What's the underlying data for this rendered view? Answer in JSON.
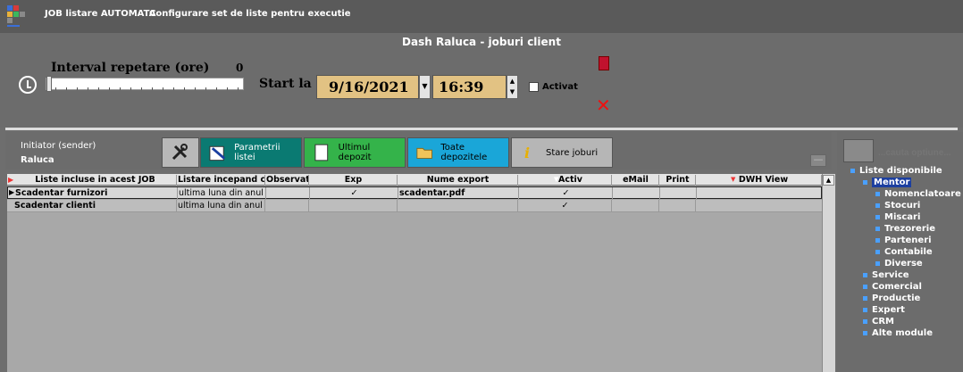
{
  "titlebar": {
    "app": "JOB listare AUTOMATA",
    "subtitle": "Configurare set de liste pentru executie"
  },
  "dash_title": "Dash Raluca - joburi client",
  "interval": {
    "label": "Interval repetare (ore)",
    "value": "0"
  },
  "start": {
    "label": "Start la",
    "date": "9/16/2021",
    "time": "16:39",
    "activ_label": "Activat"
  },
  "initiator": {
    "label": "Initiator (sender)",
    "value": "Raluca"
  },
  "toolbar": {
    "param": "Parametrii listei",
    "ultim": "Ultimul depozit",
    "toate": "Toate depozitele",
    "stare": "Stare joburi"
  },
  "grid": {
    "columns": [
      "Liste incluse in acest JOB",
      "Listare incepand cu",
      "Observatii",
      "Exp",
      "Nume export",
      "Activ",
      "eMail",
      "Print",
      "DWH View"
    ],
    "rows": [
      {
        "name": "Scadentar furnizori",
        "listare": "ultima luna din anul cure",
        "obs": "",
        "exp": "✓",
        "export": "scadentar.pdf",
        "activ": "✓",
        "email": "",
        "print": "",
        "dwh": ""
      },
      {
        "name": "Scadentar clienti",
        "listare": "ultima luna din anul cure",
        "obs": "",
        "exp": "",
        "export": "",
        "activ": "✓",
        "email": "",
        "print": "",
        "dwh": ""
      }
    ]
  },
  "search": {
    "placeholder": "...cauta optiune..."
  },
  "tree": {
    "root": "Liste disponibile",
    "mentor": "Mentor",
    "mentor_children": [
      "Nomenclatoare",
      "Stocuri",
      "Miscari",
      "Trezorerie",
      "Parteneri",
      "Contabile",
      "Diverse"
    ],
    "others": [
      "Service",
      "Comercial",
      "Productie",
      "Expert",
      "CRM",
      "Alte module"
    ]
  },
  "colors": {
    "date_bg": "#e2c283",
    "param_bg": "#0a7a72",
    "ultim_bg": "#34b34a",
    "toate_bg": "#1aa6d8"
  }
}
